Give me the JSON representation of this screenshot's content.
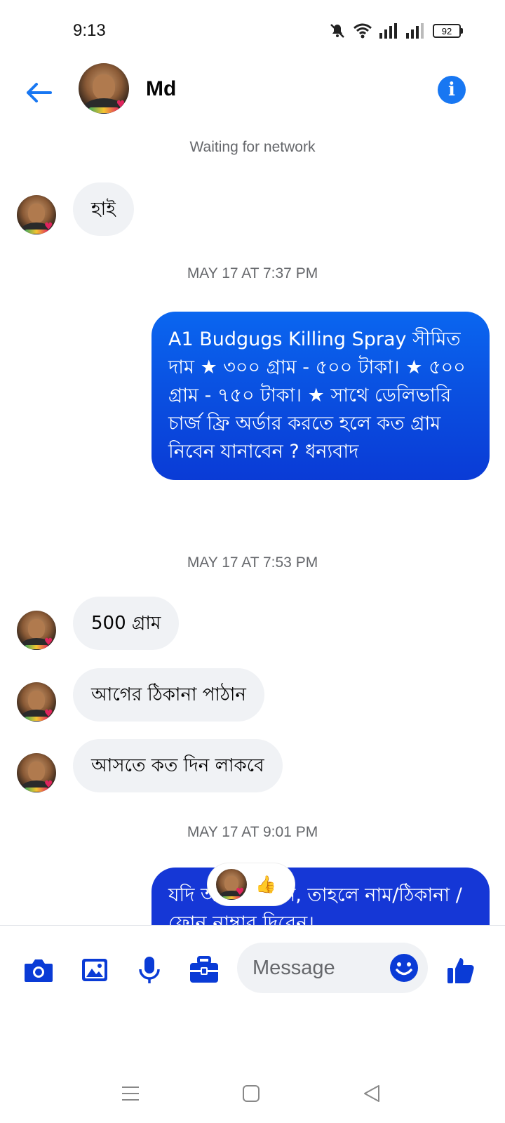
{
  "status_bar": {
    "time": "9:13",
    "battery": "92",
    "icons": [
      "mute-icon",
      "wifi-icon",
      "signal-icon",
      "signal-icon",
      "battery-icon"
    ]
  },
  "header": {
    "contact_name": "Md",
    "back_icon": "arrow-left-icon",
    "info_icon": "info-icon",
    "info_glyph": "i"
  },
  "network_status": "Waiting for network",
  "messages": [
    {
      "type": "incoming",
      "text": "হাই"
    },
    {
      "type": "timestamp",
      "text": "MAY 17 AT 7:37 PM"
    },
    {
      "type": "outgoing",
      "text": "A1 Budgugs Killing Spray সীমিত দাম ★ ৩০০ গ্রাম - ৫০০ টাকা। ★ ৫০০ গ্রাম - ৭৫০ টাকা। ★ সাথে ডেলিভারি চার্জ ফ্রি অর্ডার করতে হলে কত গ্রাম নিবেন যানাবেন ? ধন্যবাদ"
    },
    {
      "type": "timestamp",
      "text": "MAY 17 AT 7:53 PM"
    },
    {
      "type": "incoming",
      "text": "500 গ্রাম"
    },
    {
      "type": "incoming",
      "text": "আগের ঠিকানা  পাঠান"
    },
    {
      "type": "incoming",
      "text": "আসতে কত দিন লাকবে"
    },
    {
      "type": "timestamp",
      "text": "MAY 17 AT 9:01 PM"
    },
    {
      "type": "outgoing",
      "text": "যদি অর্ডার করেন, তাহলে নাম/ঠিকানা / ফোন নাম্বার দিবেন।"
    }
  ],
  "reaction": {
    "emoji": "👍",
    "icon": "thumbs-up-reaction-icon"
  },
  "composer": {
    "placeholder": "Message",
    "icons": [
      "camera-icon",
      "gallery-icon",
      "microphone-icon",
      "briefcase-icon",
      "emoji-icon",
      "like-icon"
    ]
  },
  "nav_bar": {
    "icons": [
      "menu-icon",
      "home-icon",
      "back-icon"
    ]
  },
  "colors": {
    "accent": "#1877f2",
    "outgoing_bubble": "#0a4fe0",
    "incoming_bubble": "#f0f2f5",
    "composer_icon": "#0a3bd6",
    "meta_text": "#65676b"
  }
}
